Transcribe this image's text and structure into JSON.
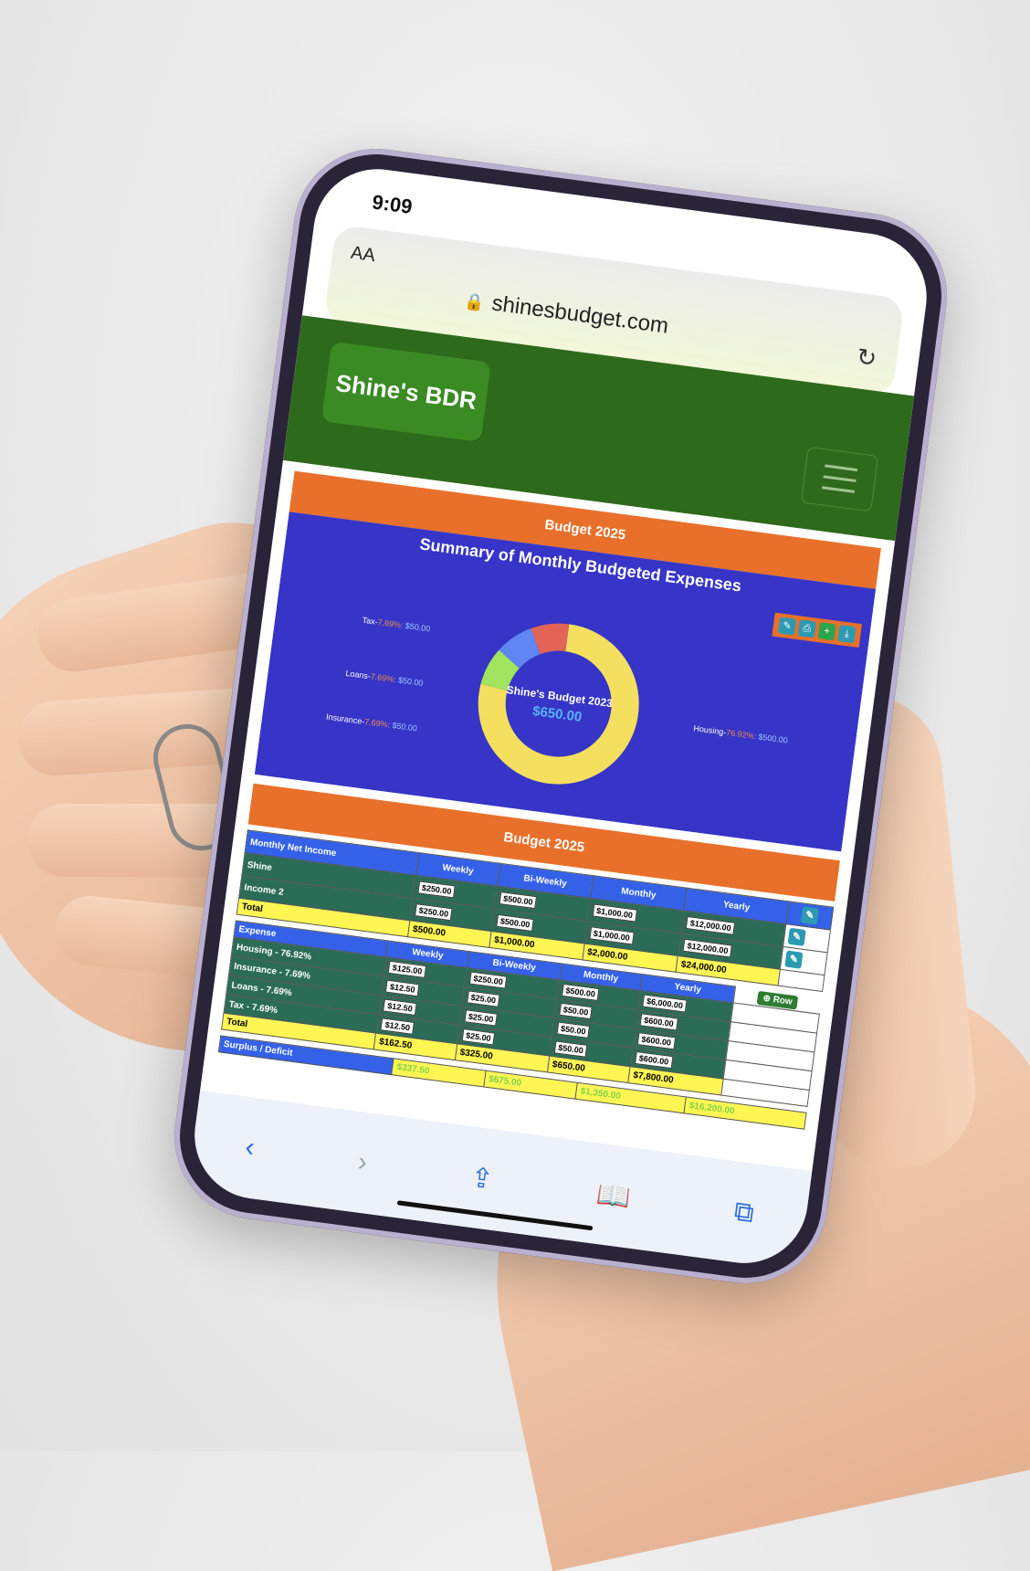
{
  "status": {
    "time": "9:09",
    "signal_icons": "▂▄▆ ◠ ▭"
  },
  "browser": {
    "aa_label": "AA",
    "url": "shinesbudget.com",
    "reload_symbol": "↻"
  },
  "site": {
    "brand": "Shine's BDR"
  },
  "panels": [
    {
      "header": "Budget 2025"
    },
    {
      "header": "Budget 2025"
    }
  ],
  "chart_data": {
    "type": "pie",
    "title": "Summary of Monthly Budgeted Expenses",
    "center_label": "Shine's Budget 2023",
    "center_value": "$650.00",
    "slices": [
      {
        "name": "Housing",
        "percent": "76.92%",
        "amount": "$500.00",
        "value": 500,
        "color": "#f5df5e"
      },
      {
        "name": "Insurance",
        "percent": "7.69%",
        "amount": "$50.00",
        "value": 50,
        "color": "#9fe35e"
      },
      {
        "name": "Loans",
        "percent": "7.69%",
        "amount": "$50.00",
        "value": 50,
        "color": "#5f86f2"
      },
      {
        "name": "Tax",
        "percent": "7.69%",
        "amount": "$50.00",
        "value": 50,
        "color": "#e26456"
      }
    ]
  },
  "income": {
    "title": "Monthly Net Income",
    "columns": [
      "Weekly",
      "Bi-Weekly",
      "Monthly",
      "Yearly"
    ],
    "rows": [
      {
        "label": "Shine",
        "values": [
          "$250.00",
          "$500.00",
          "$1,000.00",
          "$12,000.00"
        ]
      },
      {
        "label": "Income 2",
        "values": [
          "$250.00",
          "$500.00",
          "$1,000.00",
          "$12,000.00"
        ]
      }
    ],
    "total": {
      "label": "Total",
      "values": [
        "$500.00",
        "$1,000.00",
        "$2,000.00",
        "$24,000.00"
      ]
    }
  },
  "expense": {
    "title": "Expense",
    "row_button": "Row",
    "columns": [
      "Weekly",
      "Bi-Weekly",
      "Monthly",
      "Yearly"
    ],
    "rows": [
      {
        "label": "Housing - 76.92%",
        "values": [
          "$125.00",
          "$250.00",
          "$500.00",
          "$6,000.00"
        ]
      },
      {
        "label": "Insurance - 7.69%",
        "values": [
          "$12.50",
          "$25.00",
          "$50.00",
          "$600.00"
        ]
      },
      {
        "label": "Loans - 7.69%",
        "values": [
          "$12.50",
          "$25.00",
          "$50.00",
          "$600.00"
        ]
      },
      {
        "label": "Tax - 7.69%",
        "values": [
          "$12.50",
          "$25.00",
          "$50.00",
          "$600.00"
        ]
      }
    ],
    "total": {
      "label": "Total",
      "values": [
        "$162.50",
        "$325.00",
        "$650.00",
        "$7,800.00"
      ]
    }
  },
  "surplus": {
    "title": "Surplus / Deficit",
    "values": [
      "$337.50",
      "$675.00",
      "$1,350.00",
      "$16,200.00"
    ]
  },
  "safari_toolbar": {
    "back": "‹",
    "forward": "›",
    "share": "⇪",
    "bookmarks": "📖",
    "tabs": "⧉"
  }
}
